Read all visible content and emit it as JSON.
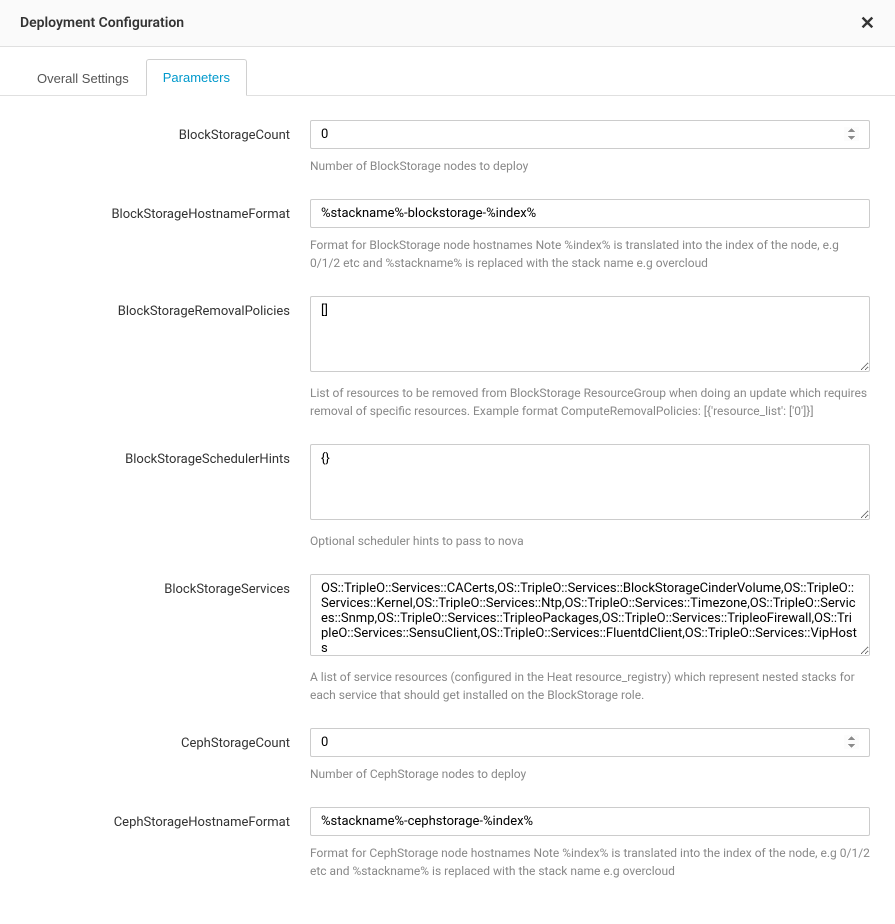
{
  "header": {
    "title": "Deployment Configuration"
  },
  "tabs": {
    "overall": "Overall Settings",
    "parameters": "Parameters"
  },
  "fields": {
    "blockStorageCount": {
      "label": "BlockStorageCount",
      "value": "0",
      "help": "Number of BlockStorage nodes to deploy"
    },
    "blockStorageHostnameFormat": {
      "label": "BlockStorageHostnameFormat",
      "value": "%stackname%-blockstorage-%index%",
      "help": "Format for BlockStorage node hostnames Note %index% is translated into the index of the node, e.g 0/1/2 etc and %stackname% is replaced with the stack name e.g overcloud"
    },
    "blockStorageRemovalPolicies": {
      "label": "BlockStorageRemovalPolicies",
      "value": "[]",
      "help": "List of resources to be removed from BlockStorage ResourceGroup when doing an update which requires removal of specific resources. Example format ComputeRemovalPolicies: [{'resource_list': ['0']}]"
    },
    "blockStorageSchedulerHints": {
      "label": "BlockStorageSchedulerHints",
      "value": "{}",
      "help": "Optional scheduler hints to pass to nova"
    },
    "blockStorageServices": {
      "label": "BlockStorageServices",
      "value": "OS::TripleO::Services::CACerts,OS::TripleO::Services::BlockStorageCinderVolume,OS::TripleO::Services::Kernel,OS::TripleO::Services::Ntp,OS::TripleO::Services::Timezone,OS::TripleO::Services::Snmp,OS::TripleO::Services::TripleoPackages,OS::TripleO::Services::TripleoFirewall,OS::TripleO::Services::SensuClient,OS::TripleO::Services::FluentdClient,OS::TripleO::Services::VipHosts",
      "help": "A list of service resources (configured in the Heat resource_registry) which represent nested stacks for each service that should get installed on the BlockStorage role."
    },
    "cephStorageCount": {
      "label": "CephStorageCount",
      "value": "0",
      "help": "Number of CephStorage nodes to deploy"
    },
    "cephStorageHostnameFormat": {
      "label": "CephStorageHostnameFormat",
      "value": "%stackname%-cephstorage-%index%",
      "help": "Format for CephStorage node hostnames Note %index% is translated into the index of the node, e.g 0/1/2 etc and %stackname% is replaced with the stack name e.g overcloud"
    }
  }
}
